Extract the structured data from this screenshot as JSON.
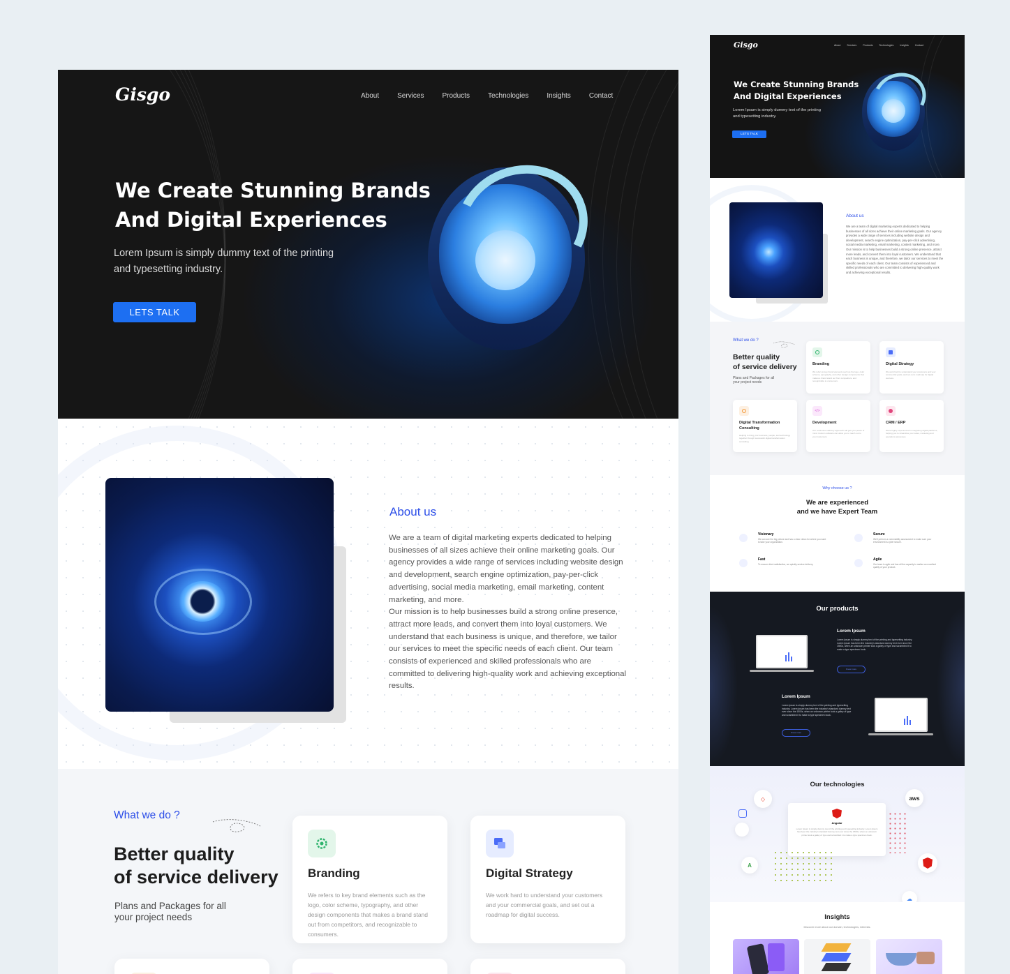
{
  "brand": {
    "logo": "Gisgo"
  },
  "nav": [
    "About",
    "Services",
    "Products",
    "Technologies",
    "Insights",
    "Contact"
  ],
  "hero": {
    "title_line1": "We Create Stunning Brands",
    "title_line2": "And Digital Experiences",
    "subtitle_line1": "Lorem Ipsum is simply dummy text of the printing",
    "subtitle_line2": "and typesetting industry.",
    "cta": "LETS TALK"
  },
  "about": {
    "heading": "About us",
    "lines": [
      "We are a team of digital marketing experts dedicated to helping",
      "businesses of all sizes achieve their online marketing goals. Our",
      "agency provides a wide range of services including website design",
      "and development, search engine optimization, pay-per-click",
      "advertising, social media marketing, email marketing, content",
      "marketing, and more.",
      "Our mission is to help businesses build a strong online presence,",
      "attract more leads, and convert them into loyal customers. We",
      "understand that each business is unique, and therefore, we tailor",
      "our services to meet the specific needs of each client. Our team",
      "consists of experienced and skilled professionals who are",
      "committed to delivering high-quality work and achieving exceptional",
      "results."
    ]
  },
  "services": {
    "eyebrow": "What we do ?",
    "title_line1": "Better quality",
    "title_line2": "of service delivery",
    "sub_line1": "Plans and Packages for all",
    "sub_line2": "your project needs",
    "cards": [
      {
        "title": "Branding",
        "icon": "gear-icon",
        "color": "#2fb36d",
        "bg": "#e3f6ea",
        "text": [
          "We refers to key brand elements such as the",
          "logo, color scheme, typography, and other",
          "design components that makes a brand stand",
          "out from competitors, and recognizable to",
          "consumers."
        ]
      },
      {
        "title": "Digital Strategy",
        "icon": "strategy-icon",
        "color": "#4a6cf7",
        "bg": "#e6ecff",
        "text": [
          "We work hard to understand your customers",
          "and your commercial goals, and set out a",
          "roadmap for digital success."
        ]
      },
      {
        "title": "Digital Transformation Consulting",
        "icon": "consulting-icon",
        "color": "#f39a3c",
        "bg": "#fdf0e2",
        "text": [
          "Helping to bring your business, people, and",
          "technology together through successful",
          "digital transformation consulting."
        ]
      },
      {
        "title": "Development",
        "icon": "code-icon",
        "color": "#d65ad8",
        "bg": "#fbe8fb",
        "text": [
          "Our continuous delivery approach will give",
          "you peace of mind. Custom software can",
          "allow you to reach out to your customers."
        ]
      },
      {
        "title": "CRM / ERP",
        "icon": "crm-icon",
        "color": "#e0457b",
        "bg": "#fde6ee",
        "text": [
          "We're highly experienced in integrating digital",
          "platforms, helping you to streamline your",
          "sales, marketing and operations processes."
        ]
      }
    ]
  },
  "why": {
    "eyebrow": "Why choose us ?",
    "title_line1": "We are experienced",
    "title_line2": "and we have Expert Team",
    "items": [
      {
        "title": "Visionary",
        "text": "We can see the big picture and has a clear vision for where you want to take your organization.",
        "icon": "eye-icon"
      },
      {
        "title": "Secure",
        "text": "We'll perform a vulnerability assessment to make sure your environment is cyber secure.",
        "icon": "shield-icon"
      },
      {
        "title": "Fast",
        "text": "To ensure client satisfaction, we quickly service delivery.",
        "icon": "rocket-icon"
      },
      {
        "title": "Agile",
        "text": "Our team is agile and has all the capacity to realize an excellent quality of your product.",
        "icon": "agile-icon"
      }
    ]
  },
  "products": {
    "heading": "Our products",
    "items": [
      {
        "title": "Lorem Ipsum",
        "text": "Lorem Ipsum is simply dummy text of the printing and typesetting industry. Lorem Ipsum has been the industry's standard dummy text ever since the 1500s, when an unknown printer took a galley of type and scrambled it to make a type specimen book.",
        "cta": "Know more"
      },
      {
        "title": "Lorem Ipsum",
        "text": "Lorem Ipsum is simply dummy text of the printing and typesetting industry. Lorem Ipsum has been the industry's standard dummy text ever since the 1500s, when an unknown printer took a galley of type and scrambled it to make a type specimen book.",
        "cta": "Know more"
      }
    ]
  },
  "technologies": {
    "heading": "Our technologies",
    "featured": "Angular",
    "featured_text": "Lorem Ipsum is simply dummy text of the printing and typesetting industry. Lorem Ipsum has been the industry's standard dummy text ever since the 1500s, when an unknown printer took a galley of type and scrambled it to make a type specimen book.",
    "aws": "aws"
  },
  "insights": {
    "heading": "Insights",
    "sub": "Discover more about our domain, technologies, interests."
  },
  "colors": {
    "accent": "#1d6ff2",
    "heading_blue": "#2b4de8",
    "dark": "#161616"
  }
}
